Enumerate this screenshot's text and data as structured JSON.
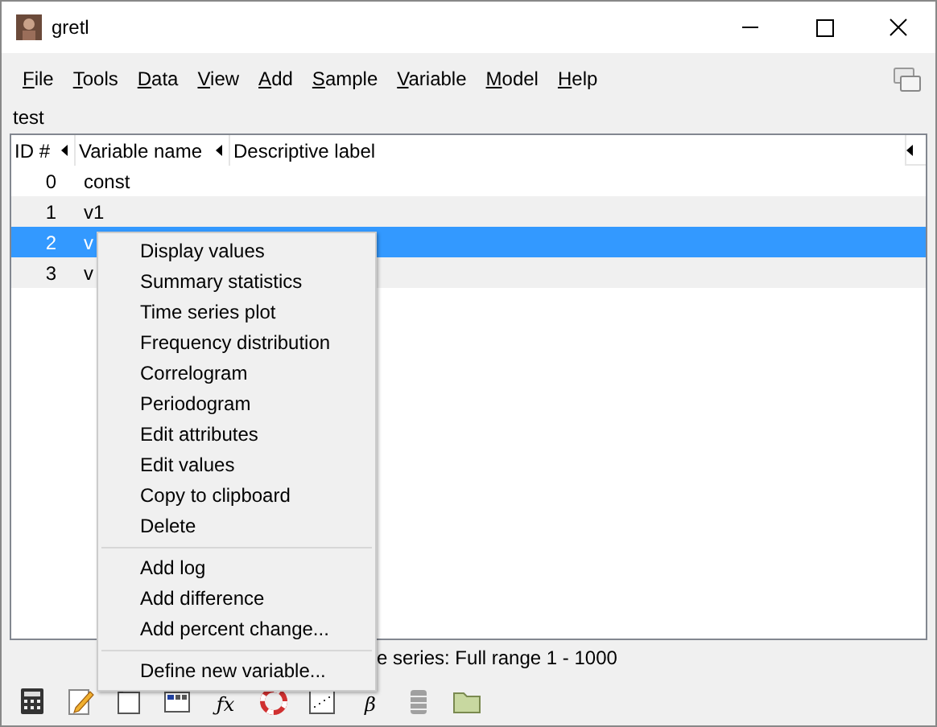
{
  "window": {
    "title": "gretl"
  },
  "menubar": [
    "File",
    "Tools",
    "Data",
    "View",
    "Add",
    "Sample",
    "Variable",
    "Model",
    "Help"
  ],
  "dataset_label": "test",
  "table": {
    "columns": [
      {
        "label": "ID #",
        "sort_arrow": true
      },
      {
        "label": "Variable name",
        "sort_arrow": true
      },
      {
        "label": "Descriptive label",
        "sort_arrow": false
      }
    ],
    "rows": [
      {
        "id": "0",
        "name": "const",
        "selected": false
      },
      {
        "id": "1",
        "name": "v1",
        "selected": false
      },
      {
        "id": "2",
        "name": "v",
        "selected": true
      },
      {
        "id": "3",
        "name": "v",
        "selected": false
      }
    ]
  },
  "status_bar": "e series: Full range 1 - 1000",
  "toolbar": [
    {
      "kind": "calculator"
    },
    {
      "kind": "notepad"
    },
    {
      "kind": "document"
    },
    {
      "kind": "matrix"
    },
    {
      "kind": "glyph",
      "text": "ƒx"
    },
    {
      "kind": "lifebuoy"
    },
    {
      "kind": "scatter"
    },
    {
      "kind": "glyph",
      "text": "β"
    },
    {
      "kind": "database"
    },
    {
      "kind": "folder"
    }
  ],
  "context_menu": [
    {
      "kind": "item",
      "label": "Display values"
    },
    {
      "kind": "item",
      "label": "Summary statistics"
    },
    {
      "kind": "item",
      "label": "Time series plot"
    },
    {
      "kind": "item",
      "label": "Frequency distribution"
    },
    {
      "kind": "item",
      "label": "Correlogram"
    },
    {
      "kind": "item",
      "label": "Periodogram"
    },
    {
      "kind": "item",
      "label": "Edit attributes"
    },
    {
      "kind": "item",
      "label": "Edit values"
    },
    {
      "kind": "item",
      "label": "Copy to clipboard"
    },
    {
      "kind": "item",
      "label": "Delete"
    },
    {
      "kind": "separator"
    },
    {
      "kind": "item",
      "label": "Add log"
    },
    {
      "kind": "item",
      "label": "Add difference"
    },
    {
      "kind": "item",
      "label": "Add percent change..."
    },
    {
      "kind": "separator"
    },
    {
      "kind": "item",
      "label": "Define new variable..."
    }
  ]
}
